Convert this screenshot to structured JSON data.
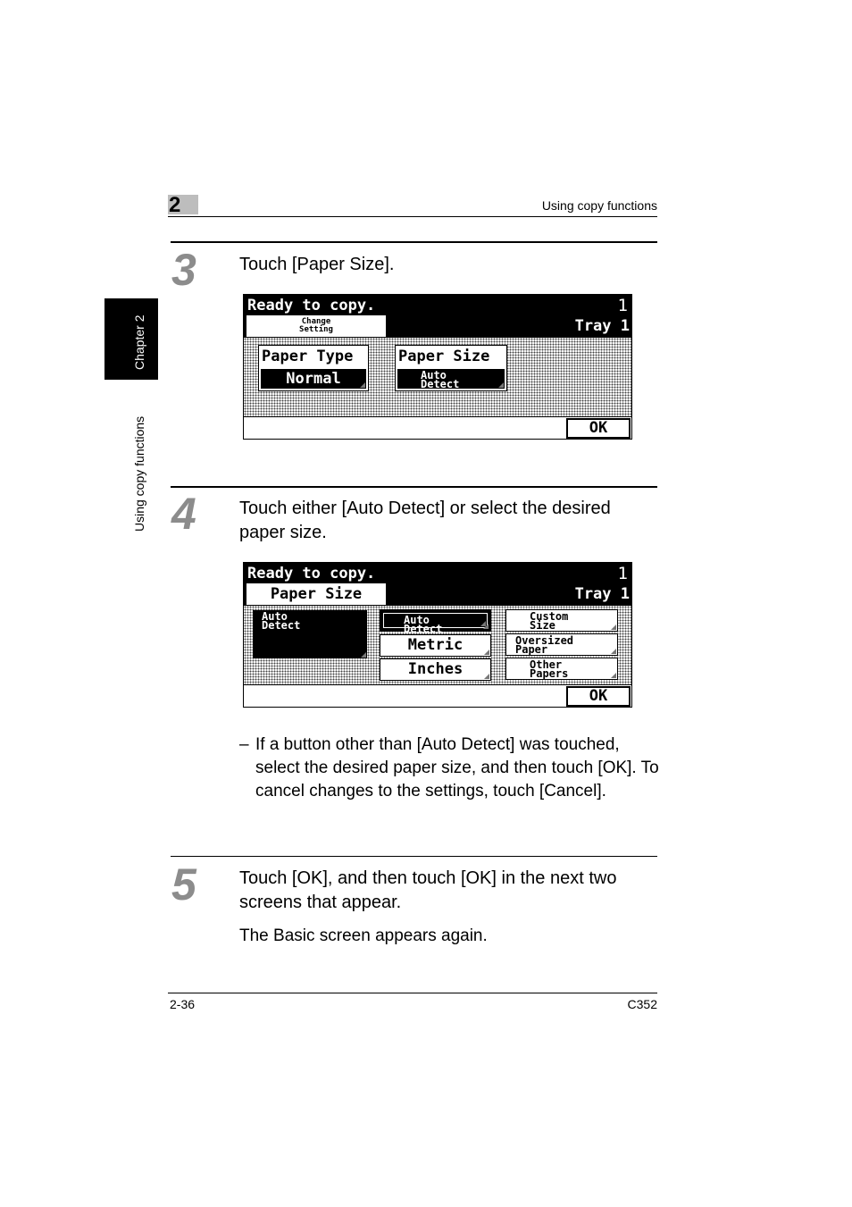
{
  "header": {
    "chapter_number": "2",
    "title": "Using copy functions"
  },
  "side_tab": {
    "chapter": "Chapter 2",
    "section": "Using copy functions"
  },
  "step3": {
    "number": "3",
    "text": "Touch [Paper Size].",
    "screen": {
      "status": "Ready to copy.",
      "count": "1",
      "tray": "Tray 1",
      "tab_line1": "Change",
      "tab_line2": "Setting",
      "paper_type_label": "Paper Type",
      "paper_type_value": "Normal",
      "paper_size_label": "Paper Size",
      "paper_size_line1": "Auto",
      "paper_size_line2": "Detect",
      "ok": "OK"
    }
  },
  "step4": {
    "number": "4",
    "text": "Touch either [Auto Detect] or select the desired paper size.",
    "screen": {
      "status": "Ready to copy.",
      "count": "1",
      "tray": "Tray 1",
      "tab": "Paper Size",
      "current_line1": "Auto",
      "current_line2": "Detect",
      "buttons": {
        "auto_detect_1": "Auto",
        "auto_detect_2": "Detect",
        "metric": "Metric",
        "inches": "Inches",
        "custom_1": "Custom",
        "custom_2": "Size",
        "oversized_1": "Oversized",
        "oversized_2": "Paper",
        "other_1": "Other",
        "other_2": "Papers"
      },
      "ok": "OK"
    },
    "note": "If a button other than [Auto Detect] was touched, select the desired paper size, and then touch [OK]. To cancel changes to the settings, touch [Cancel]."
  },
  "step5": {
    "number": "5",
    "text": "Touch [OK], and then touch [OK] in the next two screens that appear.",
    "result": "The Basic screen appears again."
  },
  "footer": {
    "page": "2-36",
    "model": "C352"
  }
}
